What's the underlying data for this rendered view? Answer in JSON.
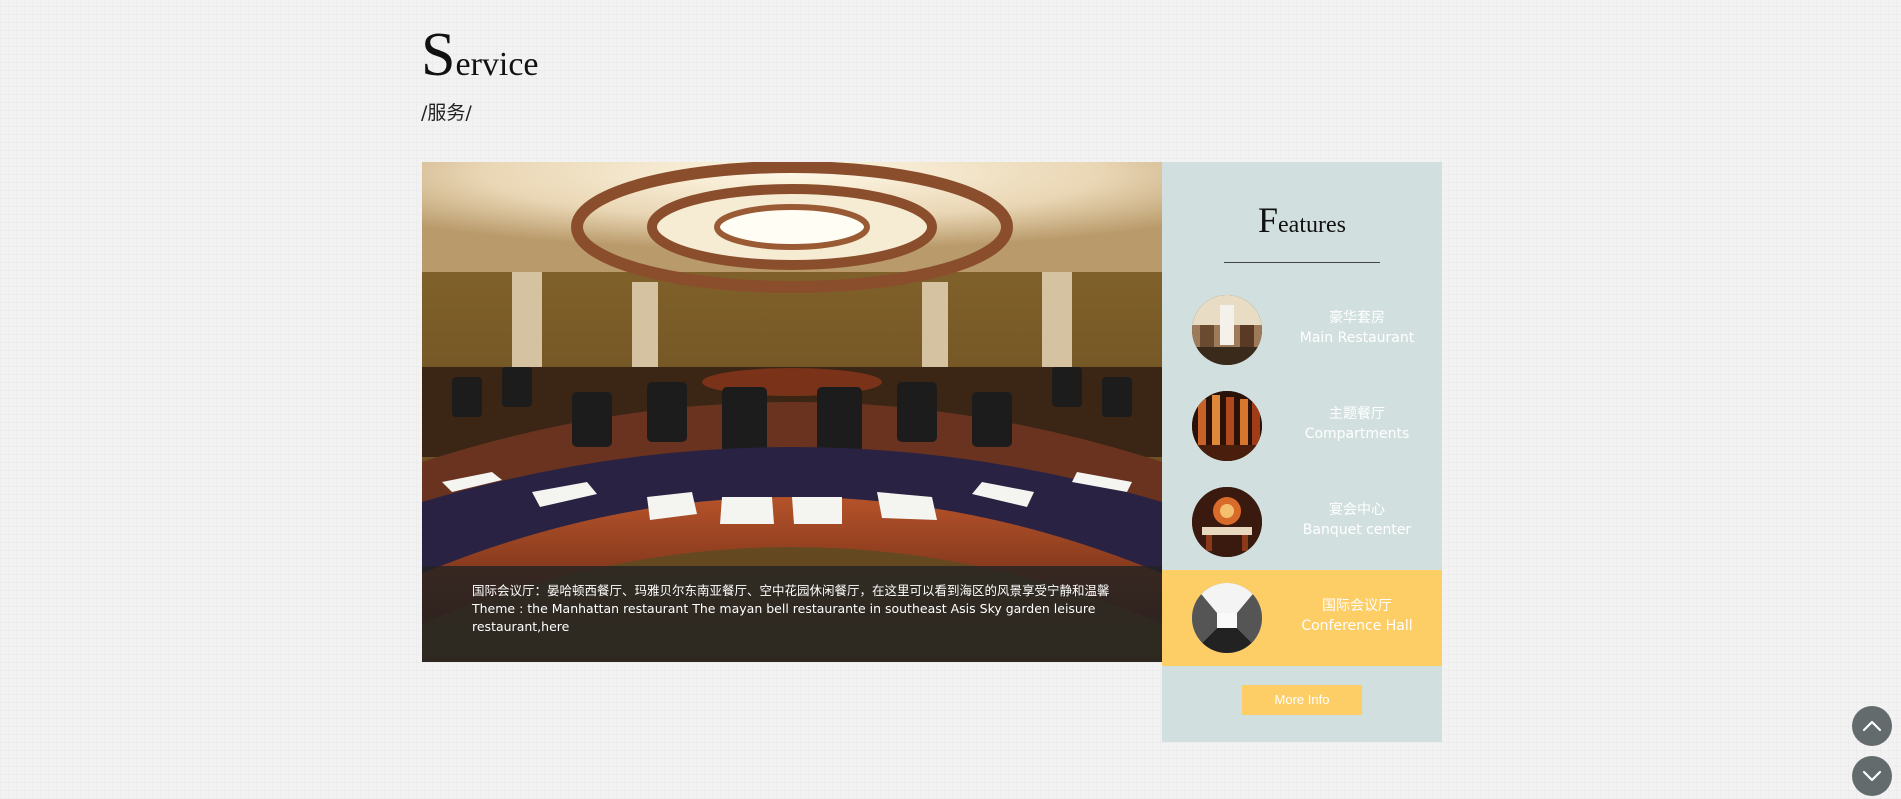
{
  "section": {
    "title_initial": "S",
    "title_rest": "ervice",
    "subtitle": "/服务/"
  },
  "hero": {
    "image": "conference-room-photo",
    "caption_line1": "国际会议厅：晏哈顿西餐厅、玛雅贝尔东南亚餐厅、空中花园休闲餐厅，在这里可以看到海区的风景享受宁静和温馨",
    "caption_line2": "Theme : the Manhattan restaurant The mayan bell restaurante in southeast Asis Sky garden leisure restaurant,here"
  },
  "features": {
    "title_initial": "F",
    "title_rest": "eatures",
    "items": [
      {
        "cn": "豪华套房",
        "en": "Main Restaurant",
        "thumb": "suite-photo",
        "active": false
      },
      {
        "cn": "主题餐厅",
        "en": "Compartments",
        "thumb": "themed-restaurant-photo",
        "active": false
      },
      {
        "cn": "宴会中心",
        "en": "Banquet center",
        "thumb": "banquet-photo",
        "active": false
      },
      {
        "cn": "国际会议厅",
        "en": "Conference Hall",
        "thumb": "conference-hall-photo",
        "active": true
      }
    ],
    "more_label": "More Info"
  },
  "scroll": {
    "up_icon": "chevron-up-icon",
    "down_icon": "chevron-down-icon"
  },
  "colors": {
    "background": "#f2f2f2",
    "panel": "#d1e0df",
    "accent": "#fdcd66",
    "scroll_button": "#636b6d"
  }
}
